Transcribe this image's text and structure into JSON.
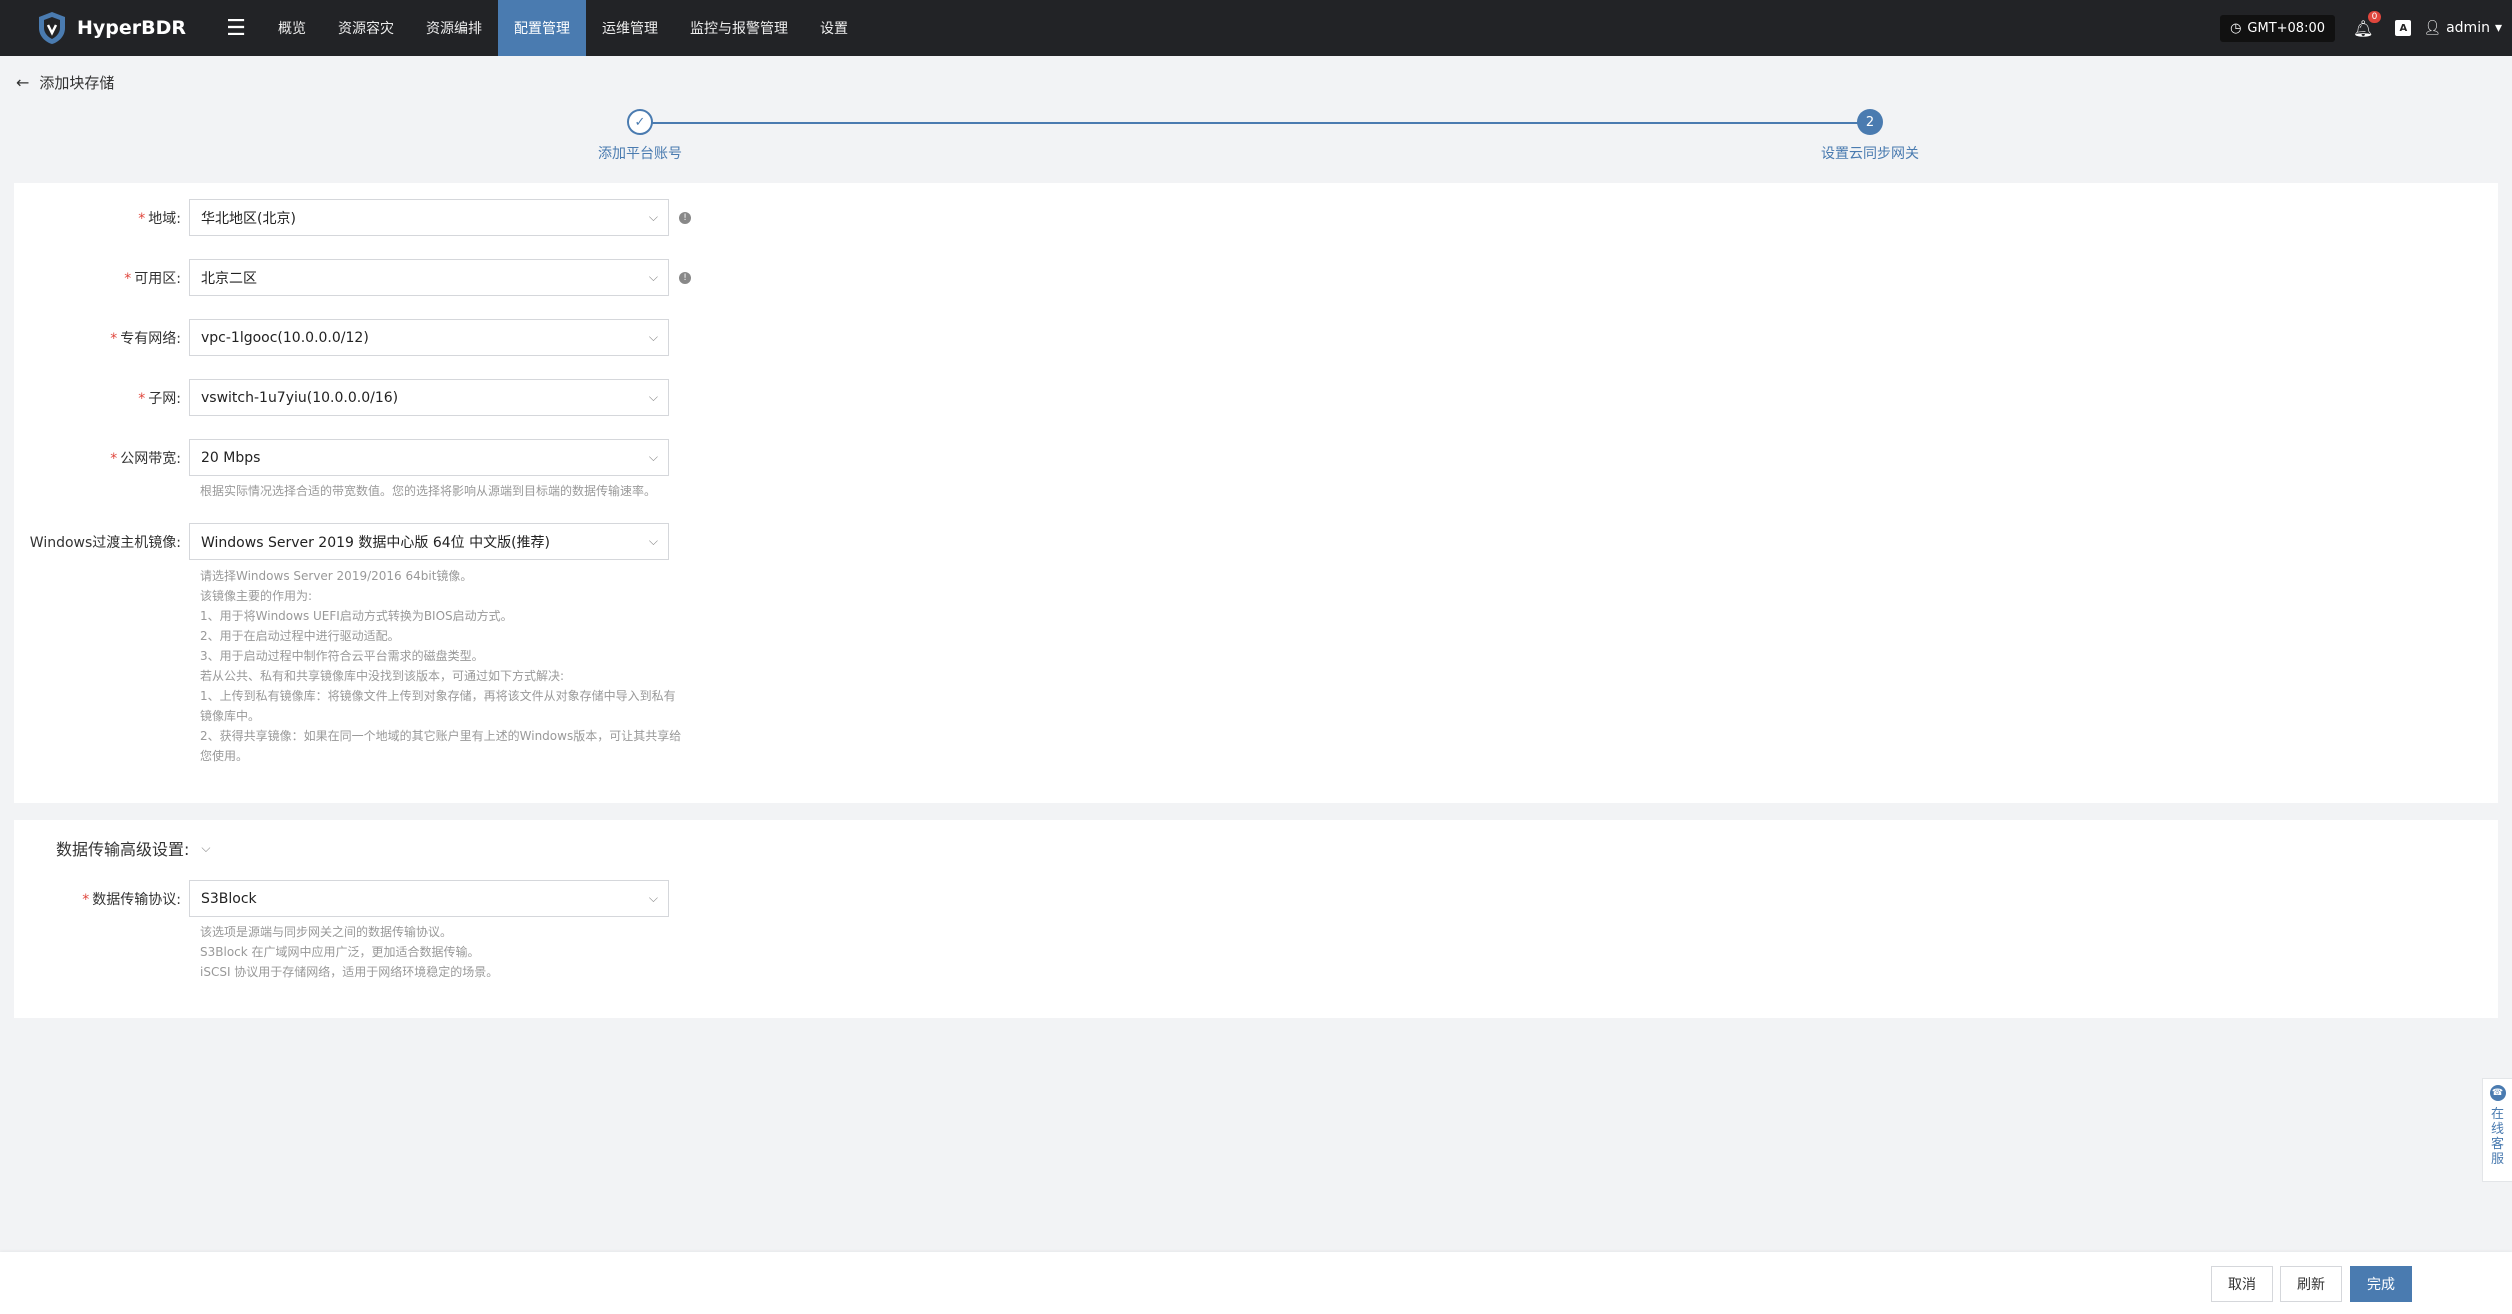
{
  "app": {
    "name": "HyperBDR",
    "logo_icon": "shield-logo-icon"
  },
  "nav": {
    "menu_icon": "hamburger-icon",
    "items": [
      {
        "label": "概览"
      },
      {
        "label": "资源容灾"
      },
      {
        "label": "资源编排"
      },
      {
        "label": "配置管理",
        "active": true
      },
      {
        "label": "运维管理"
      },
      {
        "label": "监控与报警管理"
      },
      {
        "label": "设置"
      }
    ],
    "timezone": "GMT+08:00",
    "notification_count": "0",
    "lang_icon": "A",
    "user": "admin"
  },
  "page": {
    "back_label": "添加块存储"
  },
  "stepper": {
    "step1_label": "添加平台账号",
    "step1_state": "done",
    "step2_number": "2",
    "step2_label": "设置云同步网关"
  },
  "form": {
    "region": {
      "label": "地域:",
      "value": "华北地区(北京)"
    },
    "zone": {
      "label": "可用区:",
      "value": "北京二区"
    },
    "vpc": {
      "label": "专有网络:",
      "value": "vpc-1lgooc(10.0.0.0/12)"
    },
    "subnet": {
      "label": "子网:",
      "value": "vswitch-1u7yiu(10.0.0.0/16)"
    },
    "bandwidth": {
      "label": "公网带宽:",
      "value": "20 Mbps",
      "hint": "根据实际情况选择合适的带宽数值。您的选择将影响从源端到目标端的数据传输速率。"
    },
    "windows_image": {
      "label": "Windows过渡主机镜像:",
      "value": "Windows Server 2019 数据中心版 64位 中文版(推荐)",
      "hints": [
        "请选择Windows Server 2019/2016 64bit镜像。",
        "该镜像主要的作用为:",
        "1、用于将Windows UEFI启动方式转换为BIOS启动方式。",
        "2、用于在启动过程中进行驱动适配。",
        "3、用于启动过程中制作符合云平台需求的磁盘类型。",
        "若从公共、私有和共享镜像库中没找到该版本，可通过如下方式解决:",
        "1、上传到私有镜像库：将镜像文件上传到对象存储，再将该文件从对象存储中导入到私有",
        "镜像库中。",
        "2、获得共享镜像：如果在同一个地域的其它账户里有上述的Windows版本，可让其共享给",
        "您使用。"
      ]
    }
  },
  "advanced": {
    "title": "数据传输高级设置:",
    "protocol": {
      "label": "数据传输协议:",
      "value": "S3Block",
      "hints": [
        "该选项是源端与同步网关之间的数据传输协议。",
        "S3Block 在广域网中应用广泛，更加适合数据传输。",
        "iSCSI 协议用于存储网络，适用于网络环境稳定的场景。"
      ]
    }
  },
  "footer": {
    "cancel": "取消",
    "refresh": "刷新",
    "finish": "完成"
  },
  "service": {
    "label": "在线客服"
  },
  "colors": {
    "topbar": "#222326",
    "accent": "#4a7bb0",
    "required": "#e0463d"
  }
}
